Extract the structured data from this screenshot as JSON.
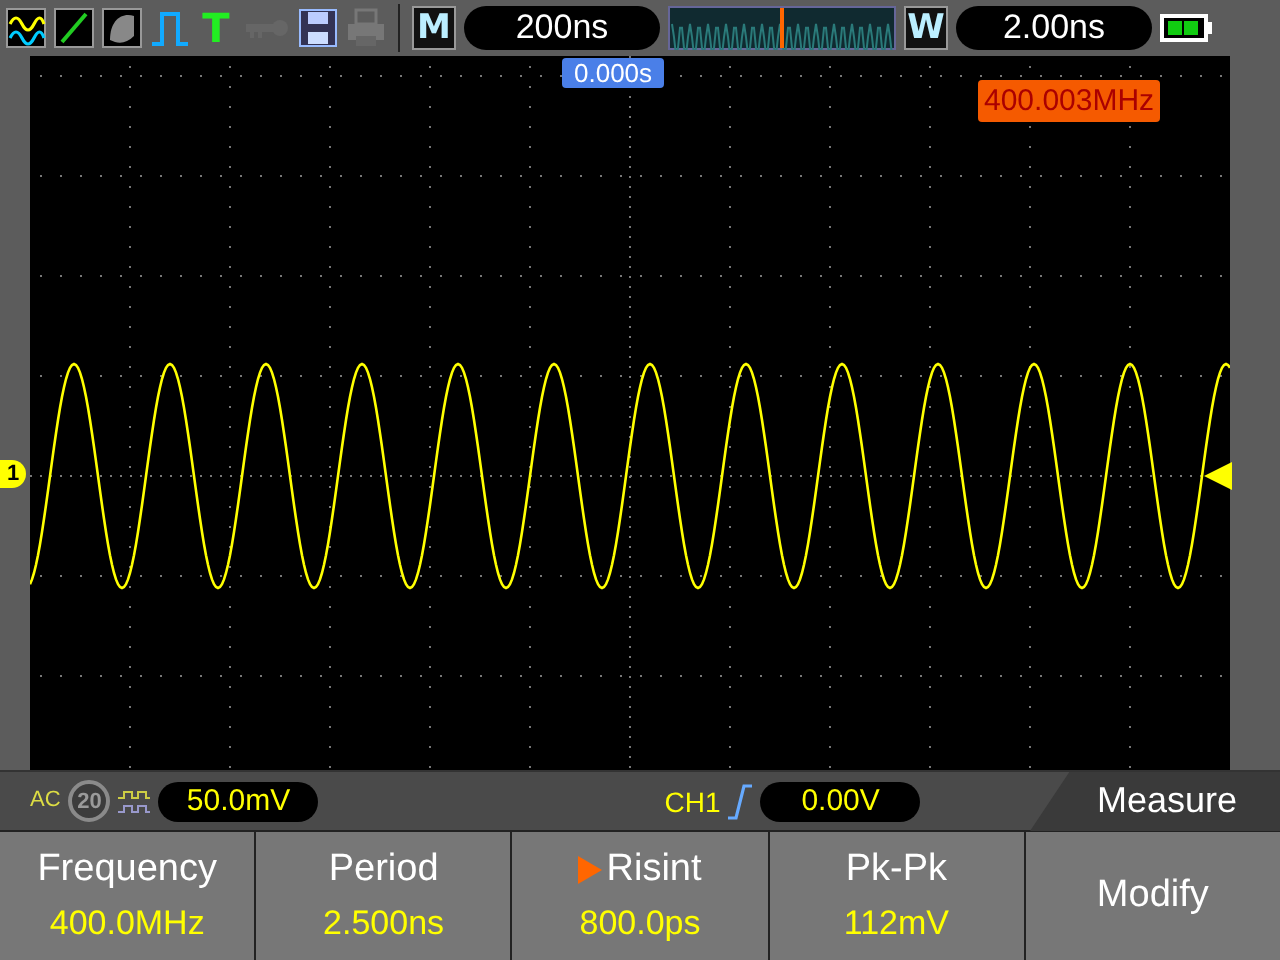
{
  "toolbar": {
    "trigger_key": "T",
    "main_key": "M",
    "timebase": "200ns",
    "window_key": "W",
    "window_timebase": "2.00ns"
  },
  "plot": {
    "trigger_position": "0.000s",
    "frequency_counter": "400.003MHz",
    "channel_marker": "1"
  },
  "status": {
    "coupling": "AC",
    "bandwidth_limit": {
      "label": "20",
      "on": false
    },
    "volts_div": "50.0mV",
    "trigger_source": "CH1",
    "trigger_level": "0.00V"
  },
  "menu": {
    "title": "Measure",
    "items": [
      {
        "label": "Frequency",
        "value": "400.0MHz",
        "selected": false
      },
      {
        "label": "Period",
        "value": "2.500ns",
        "selected": false
      },
      {
        "label": "Risint",
        "value": "800.0ps",
        "selected": true
      },
      {
        "label": "Pk-Pk",
        "value": "112mV",
        "selected": false
      },
      {
        "label": "Modify",
        "selected": false
      }
    ]
  }
}
